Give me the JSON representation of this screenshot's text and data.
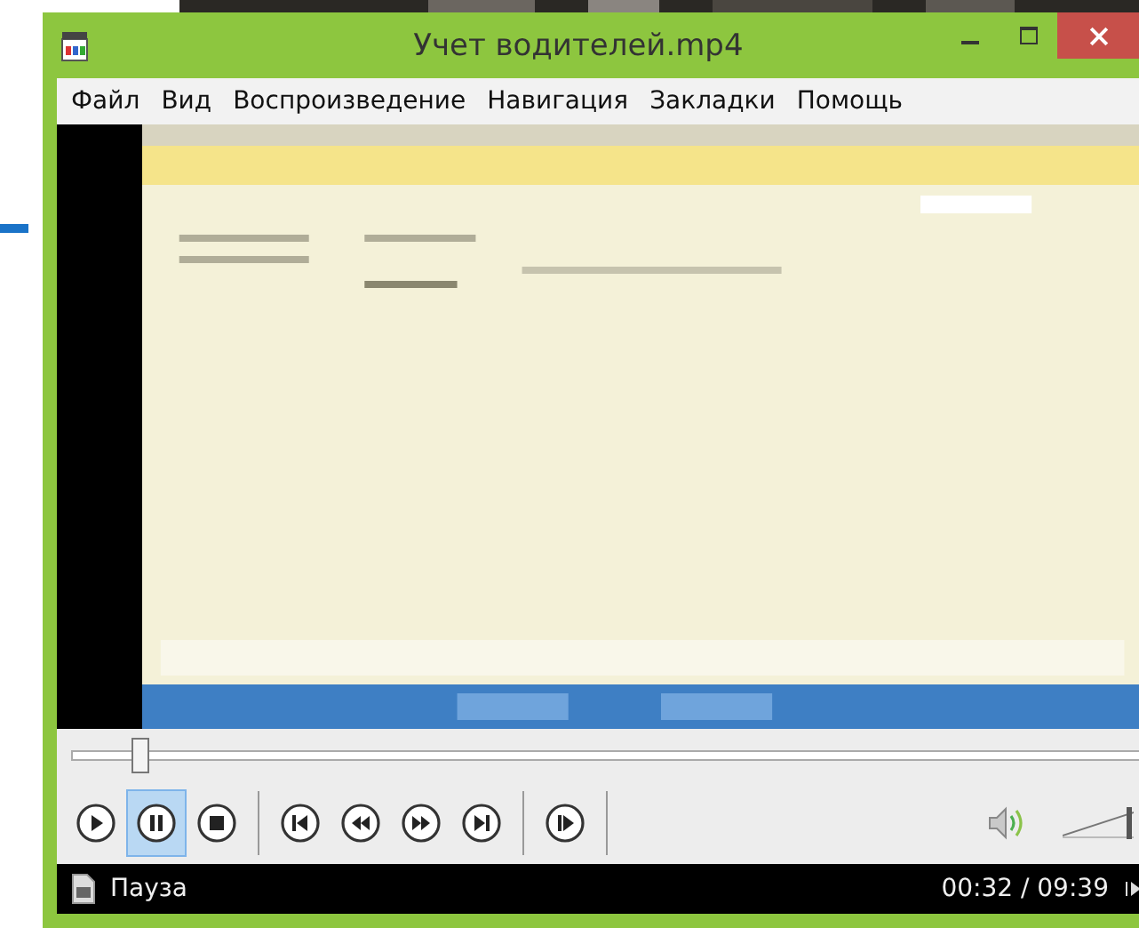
{
  "window": {
    "title": "Учет водителей.mp4"
  },
  "menu": [
    "Файл",
    "Вид",
    "Воспроизведение",
    "Навигация",
    "Закладки",
    "Помощь"
  ],
  "seek_bar": {
    "level": 0.055
  },
  "controls": [
    {
      "kind": "play",
      "selected": false
    },
    {
      "kind": "pause",
      "selected": true
    },
    {
      "kind": "stop",
      "selected": false
    },
    {
      "kind": "prev",
      "selected": false
    },
    {
      "kind": "rewind",
      "selected": false
    },
    {
      "kind": "forward",
      "selected": false
    },
    {
      "kind": "next",
      "selected": false
    },
    {
      "kind": "step",
      "selected": false
    }
  ],
  "volume": {
    "level": 0.9
  },
  "status_bar": {
    "state": "Пауза",
    "time": "00:32 / 09:39"
  }
}
